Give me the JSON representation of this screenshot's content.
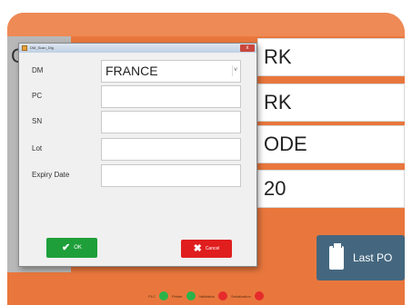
{
  "background_fields": {
    "left_clipped_char": "C",
    "values": [
      "RK",
      "RK",
      "ODE",
      "20"
    ]
  },
  "last_po_button": {
    "label": "Last PO",
    "icon": "clipboard-icon"
  },
  "dialog": {
    "title": "DM_Scan_Dlg",
    "close_label": "x",
    "labels": {
      "dm": "DM",
      "pc": "PC",
      "sn": "SN",
      "lot": "Lot",
      "expiry": "Expiry Date"
    },
    "dm_value": "FRANCE",
    "dropdown_arrow": "˅",
    "ok_label": "OK",
    "cancel_label": "Cancel"
  },
  "status_legend": {
    "items": [
      {
        "label": "PLC",
        "color": "#2bb34a"
      },
      {
        "label": "Printer",
        "color": "#2bb34a"
      },
      {
        "label": "Validation",
        "color": "#e52b2b"
      },
      {
        "label": "Serialization",
        "color": "#e52b2b"
      }
    ]
  },
  "colors": {
    "accent_orange": "#e9773d",
    "ok_green": "#1e9f3a",
    "cancel_red": "#e01e1e",
    "lastpo_blue": "#44677f"
  }
}
